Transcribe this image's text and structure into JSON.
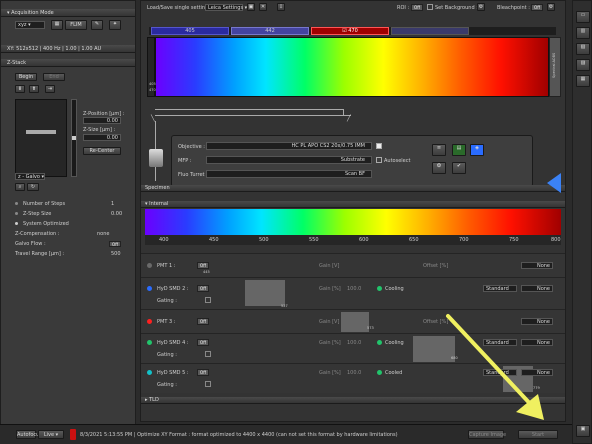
{
  "left": {
    "acq_mode_label": "Acquisition Mode",
    "scan_mode": "xyz",
    "flim_label": "FLIM",
    "xy_summary": "XY: 512x512 | 400 Hz | 1.00 | 1.00 AU",
    "zstack_label": "Z-Stack",
    "begin_label": "Begin",
    "end_label": "End",
    "zpos_label": "Z-Position [µm] :",
    "zpos_value": "0.00",
    "zsize_label": "Z-Size [µm] :",
    "zsize_value": "0.00",
    "recenter_label": "Re-Center",
    "zgalvo_label": "z - Galvo",
    "num_steps_label": "Number of Steps",
    "num_steps_value": "1",
    "zstep_label": "Z-Step Size",
    "zstep_value": "0.00",
    "sys_opt_label": "System Optimized",
    "zcomp_label": "Z-Compensation :",
    "zcomp_value": "none",
    "galvo_flow_label": "Galvo Flow :",
    "galvo_flow_toggle": "Off",
    "travel_label": "Travel Range [µm] :",
    "travel_value": "500"
  },
  "top": {
    "load_save_label": "Load/Save single setting :",
    "setting_value": "Leica Settings",
    "roi_label": "ROI :",
    "roi_toggle": "Off",
    "set_bg_label": "Set Background :",
    "bleach_label": "Bleachpoint :",
    "bleach_toggle": "Off"
  },
  "laser": {
    "boxes": [
      "405",
      "442",
      "470"
    ],
    "side_label": "Spectral AOBS",
    "side_vals": [
      "405",
      "470"
    ]
  },
  "objective": {
    "objective_label": "Objective :",
    "objective_value": "HC PL APO CS2    20x/0.75 IMM",
    "mfp_label": "MFP :",
    "mfp_value": "Substrate",
    "autoselect_label": "Autoselect",
    "fluo_label": "Fluo Turret :",
    "fluo_value": "Scan BF",
    "specimen_label": "Specimen"
  },
  "internal": {
    "header": "Internal",
    "ticks": [
      "400",
      "450",
      "500",
      "550",
      "600",
      "650",
      "700",
      "750",
      "800"
    ],
    "detectors": [
      {
        "name": "PMT 1 :",
        "gain": "Gain [V]",
        "offset": "Offset [%]",
        "pseudo": "None",
        "marker": "445",
        "gating": ""
      },
      {
        "name": "HyD SMD 2 :",
        "gain": "Gain [%]",
        "gval": "100.0",
        "status": "Cooling",
        "mode": "Standard",
        "pseudo": "None",
        "marker": "527",
        "gating": "Gating :"
      },
      {
        "name": "PMT 3 :",
        "gain": "Gain [V]",
        "offset": "Offset [%]",
        "pseudo": "None",
        "marker": "573",
        "gating": ""
      },
      {
        "name": "HyD SMD 4 :",
        "gain": "Gain [%]",
        "gval": "100.0",
        "status": "Cooling",
        "mode": "Standard",
        "pseudo": "None",
        "marker": "680",
        "gating": "Gating :"
      },
      {
        "name": "HyD SMD 5 :",
        "gain": "Gain [%]",
        "gval": "100.0",
        "status": "Cooled",
        "mode": "Standard",
        "pseudo": "None",
        "marker": "779",
        "gating": "Gating :"
      }
    ],
    "row_toggle": "Off",
    "tld_label": "TLD"
  },
  "bottom": {
    "autofocus": "Autofocus",
    "live": "Live",
    "message": "8/3/2021 5:13:55 PM | Optimize XY Format : format optimized to 4400 x 4400 (can not set this format by hardware limitations)",
    "capture": "Capture Image",
    "start": "Start"
  },
  "colors": {
    "arrow": "#f0f060",
    "dot_blue": "#2a6cff",
    "dot_red": "#ff2020",
    "dot_green": "#21c46b",
    "dot_cyan": "#13c1c8"
  }
}
